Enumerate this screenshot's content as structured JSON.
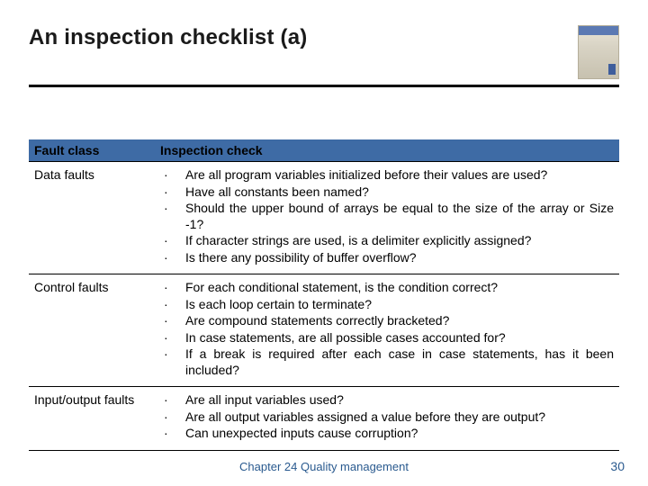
{
  "title": "An inspection checklist (a)",
  "table": {
    "headers": {
      "col1": "Fault class",
      "col2": "Inspection check"
    },
    "rows": [
      {
        "fault": "Data faults",
        "checks": [
          "Are all program variables initialized before their values are used?",
          "Have all constants been named?",
          "Should the upper bound of arrays be equal to the size of the array or Size -1?",
          "If character strings are used, is a delimiter explicitly assigned?",
          "Is there any possibility of buffer overflow?"
        ]
      },
      {
        "fault": "Control faults",
        "checks": [
          "For each conditional statement, is the condition correct?",
          "Is each loop certain to terminate?",
          "Are compound statements correctly bracketed?",
          "In case statements, are all possible cases accounted for?",
          "If a break is required after each case in case statements, has it been included?"
        ]
      },
      {
        "fault": "Input/output faults",
        "checks": [
          "Are all input variables used?",
          "Are all output variables assigned a value before they are output?",
          "Can unexpected inputs cause corruption?"
        ]
      }
    ]
  },
  "footer": "Chapter 24 Quality management",
  "page_number": "30",
  "icons": {
    "book_cover": "software-engineering-book"
  }
}
